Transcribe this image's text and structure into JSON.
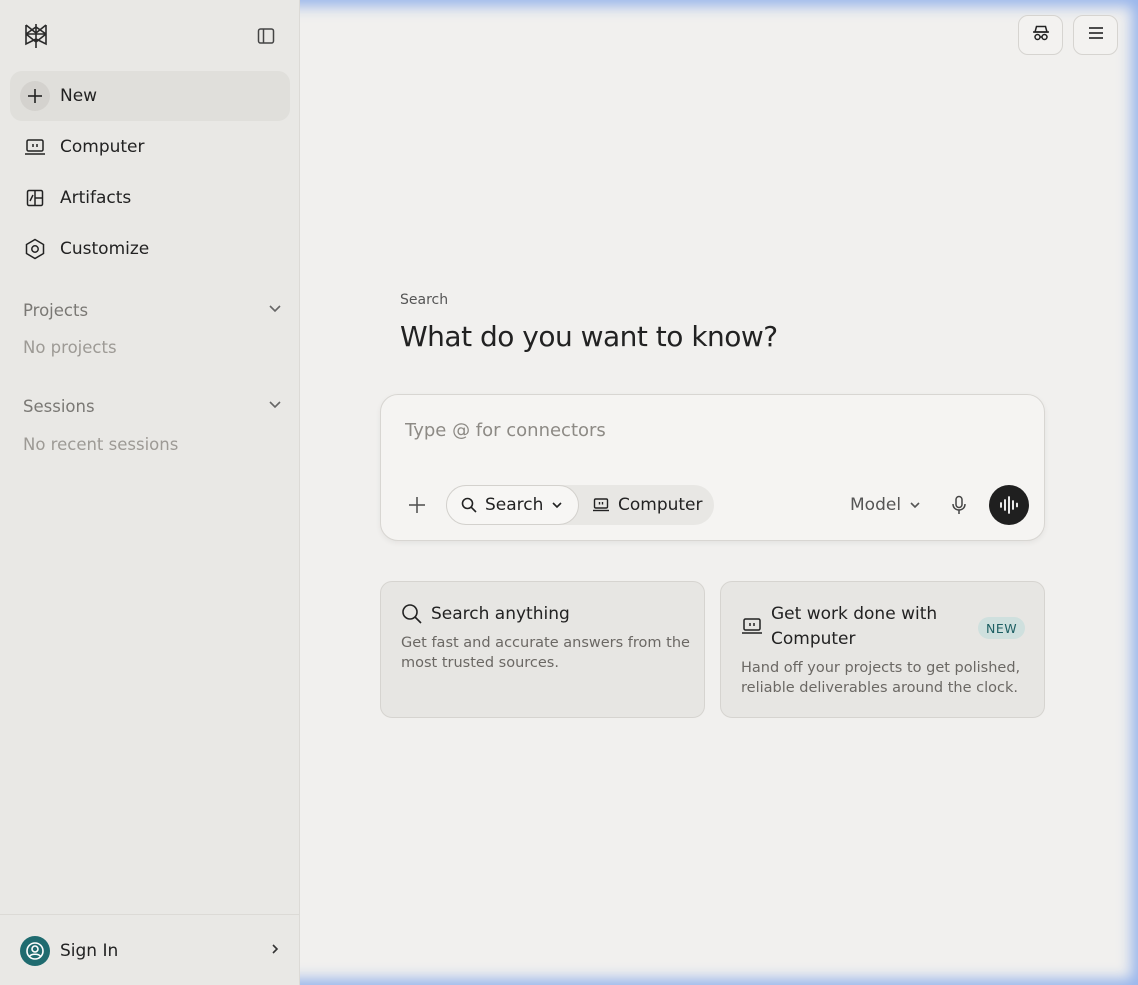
{
  "sidebar": {
    "logo_icon": "perplexity-logo-icon",
    "collapse_icon": "sidebar-toggle-icon",
    "nav": [
      {
        "label": "New",
        "icon": "plus-icon"
      },
      {
        "label": "Computer",
        "icon": "computer-icon"
      },
      {
        "label": "Artifacts",
        "icon": "artifacts-icon"
      },
      {
        "label": "Customize",
        "icon": "hexagon-settings-icon"
      }
    ],
    "projects": {
      "title": "Projects",
      "empty": "No projects"
    },
    "sessions": {
      "title": "Sessions",
      "empty": "No recent sessions"
    },
    "footer": {
      "label": "Sign In",
      "avatar_color": "#1f6b6f"
    }
  },
  "topbar": {
    "incognito_icon": "incognito-icon",
    "menu_icon": "hamburger-menu-icon"
  },
  "main": {
    "eyebrow": "Search",
    "headline": "What do you want to know?",
    "composer": {
      "placeholder": "Type @ for connectors",
      "value": "",
      "mode_search": "Search",
      "mode_computer": "Computer",
      "model_label": "Model"
    },
    "cards": [
      {
        "title": "Search anything",
        "desc_lines": [
          "Get fast and accurate answers from the",
          "most trusted sources."
        ]
      },
      {
        "title_lines": [
          "Get work done with",
          "Computer"
        ],
        "badge": "NEW",
        "desc_lines": [
          "Hand off your projects to get polished,",
          "reliable deliverables around the clock."
        ]
      }
    ]
  },
  "colors": {
    "background": "#f1f0ee",
    "sidebar": "#e9e8e5",
    "accent": "#1f6b6f",
    "voice_button": "#1f1f1f"
  }
}
